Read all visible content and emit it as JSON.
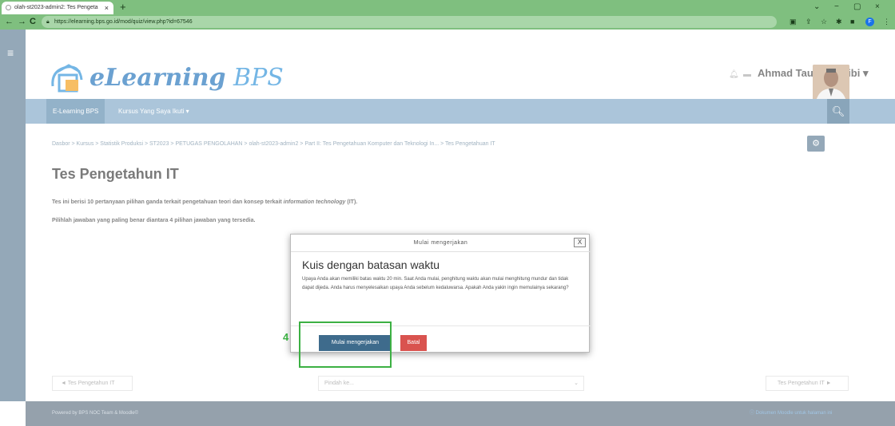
{
  "browser": {
    "tab_title": "olah-st2023-admin2: Tes Pengeta",
    "tab_close": "×",
    "new_tab": "+",
    "url": "https://elearning.bps.go.id/mod/quiz/view.php?id=67546",
    "window_controls": [
      "⌄",
      "−",
      "▢",
      "×"
    ],
    "profile_initial": "F"
  },
  "header": {
    "logo_text": "eLearning",
    "logo_suffix": " BPS",
    "username": "Ahmad Taufik Habibi"
  },
  "nav": {
    "items": [
      {
        "label": "E-Learning BPS"
      },
      {
        "label": "Kursus Yang Saya Ikuti ▾"
      }
    ]
  },
  "breadcrumb": "Dasbor  >  Kursus  >  Statistik Produksi  >  ST2023  >  PETUGAS PENGOLAHAN  >  olah-st2023-admin2  >  Part II: Tes Pengetahuan Komputer dan Teknologi In...  >  Tes Pengetahuan IT",
  "page": {
    "title": "Tes Pengetahun IT",
    "intro_part1": "Tes ini berisi 10 pertanyaan pilihan ganda terkait pengetahuan teori dan konsep terkait ",
    "intro_italic": "information technology",
    "intro_part2": " (IT).",
    "intro_line2": "Pilihlah jawaban yang paling benar diantara 4 pilihan jawaban yang tersedia."
  },
  "modal": {
    "header": "Mulai mengerjakan",
    "close": "X",
    "title": "Kuis dengan batasan waktu",
    "body": "Upaya Anda akan memiliki batas waktu 20 min. Saat Anda mulai, penghitung waktu akan mulai menghitung mundur dan tidak dapat dijeda. Anda harus menyelesaikan upaya Anda sebelum kedaluwarsa. Apakah Anda yakin ingin memulainya sekarang?",
    "start_label": "Mulai mengerjakan",
    "cancel_label": "Batal"
  },
  "annotation": {
    "step": "4",
    "color": "#3cb043"
  },
  "activity_nav": {
    "prev": "◄ Tes Pengetahun IT",
    "jump_placeholder": "Pindah ke...",
    "next": "Tes Pengetahun IT ►"
  },
  "footer": {
    "left": "Powered by BPS NOC Team & Moodle©",
    "right": "ⓘ Dokumen Moodle untuk halaman ini"
  },
  "colors": {
    "browser_chrome": "#7fbf7f",
    "navbar": "#7ea7c6",
    "primary_button": "#3e6b8c",
    "danger_button": "#d9534f"
  }
}
